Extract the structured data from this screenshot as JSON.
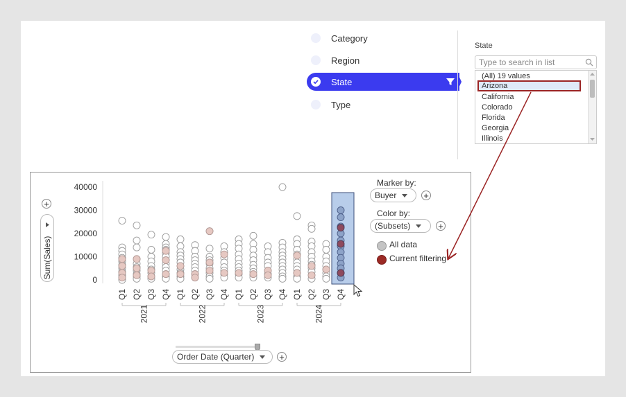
{
  "filters": {
    "items": [
      {
        "label": "Category",
        "selected": false
      },
      {
        "label": "Region",
        "selected": false
      },
      {
        "label": "State",
        "selected": true
      },
      {
        "label": "Type",
        "selected": false
      }
    ]
  },
  "state_panel": {
    "title": "State",
    "search_placeholder": "Type to search in list",
    "items": [
      "(All) 19 values",
      "Arizona",
      "California",
      "Colorado",
      "Florida",
      "Georgia",
      "Illinois"
    ],
    "selected": "Arizona"
  },
  "viz": {
    "y_axis_pill": "Sum(Sales)",
    "x_axis_pill": "Order Date (Quarter)",
    "marker_by_label": "Marker by:",
    "marker_by_value": "Buyer",
    "color_by_label": "Color by:",
    "color_by_value": "(Subsets)",
    "legend": [
      {
        "label": "All data",
        "color": "#c4c4c4"
      },
      {
        "label": "Current filtering",
        "color": "#9b2a25"
      }
    ]
  },
  "chart_data": {
    "type": "scatter",
    "y_ticks": [
      "40000",
      "30000",
      "20000",
      "10000",
      "0"
    ],
    "ylim": [
      0,
      40000
    ],
    "quarter_labels": [
      "Q1",
      "Q2",
      "Q3",
      "Q4",
      "Q1",
      "Q2",
      "Q3",
      "Q4",
      "Q1",
      "Q2",
      "Q3",
      "Q4",
      "Q1",
      "Q2",
      "Q3",
      "Q4"
    ],
    "year_labels": [
      "2021",
      "2022",
      "2023",
      "2024"
    ],
    "highlighted_category_index": 15,
    "columns": [
      {
        "all": [
          25500,
          14000,
          12500,
          11000,
          9500,
          8000,
          6500,
          5000,
          3500,
          2000,
          1000,
          0
        ],
        "filtered": [
          9000,
          6000,
          3000,
          1000
        ]
      },
      {
        "all": [
          23500,
          17000,
          14000,
          9000,
          7000,
          5500,
          4000,
          2500,
          1500,
          500
        ],
        "filtered": [
          9000,
          5000,
          2000
        ]
      },
      {
        "all": [
          19500,
          13000,
          10000,
          8000,
          6000,
          4500,
          3000,
          1500,
          500
        ],
        "filtered": [
          4000,
          1500
        ]
      },
      {
        "all": [
          18500,
          15500,
          14000,
          13000,
          11500,
          10000,
          8500,
          7000,
          5500,
          4000,
          2500,
          1500,
          500
        ],
        "filtered": [
          12500,
          8500,
          2500
        ]
      },
      {
        "all": [
          17500,
          14500,
          12000,
          10500,
          9000,
          7500,
          6000,
          4500,
          3000,
          1500,
          500
        ],
        "filtered": [
          6000,
          2500
        ]
      },
      {
        "all": [
          15000,
          12500,
          10000,
          8500,
          7000,
          5500,
          4000,
          2500,
          1000
        ],
        "filtered": [
          2500,
          1000
        ]
      },
      {
        "all": [
          21000,
          13500,
          10000,
          8500,
          7000,
          5000,
          3000,
          1500,
          500
        ],
        "filtered": [
          21000,
          7500,
          4000
        ]
      },
      {
        "all": [
          14500,
          12000,
          9500,
          7500,
          5500,
          4000,
          2500,
          1000
        ],
        "filtered": [
          11000,
          3000
        ]
      },
      {
        "all": [
          17500,
          15500,
          13500,
          11000,
          9000,
          7000,
          5500,
          4000,
          2500,
          1000
        ],
        "filtered": [
          3000
        ]
      },
      {
        "all": [
          19000,
          15500,
          13000,
          10500,
          8500,
          6500,
          5000,
          3500,
          2000,
          1000
        ],
        "filtered": [
          2500
        ]
      },
      {
        "all": [
          14500,
          12000,
          9500,
          7500,
          6000,
          4000,
          2500,
          1000
        ],
        "filtered": [
          4000,
          2000
        ]
      },
      {
        "all": [
          40000,
          16000,
          14000,
          12000,
          10500,
          9000,
          7500,
          6000,
          4500,
          3000,
          1500,
          500
        ],
        "filtered": []
      },
      {
        "all": [
          27500,
          17500,
          15500,
          13000,
          11000,
          9000,
          7500,
          6000,
          4500,
          3000,
          1500,
          500
        ],
        "filtered": [
          10500,
          3000
        ]
      },
      {
        "all": [
          23500,
          22000,
          16500,
          14500,
          12000,
          10000,
          8000,
          6500,
          5000,
          3500,
          2000,
          500
        ],
        "filtered": [
          6000,
          2000
        ]
      },
      {
        "all": [
          15500,
          13000,
          10000,
          8000,
          6000,
          4500,
          3000,
          1500,
          500
        ],
        "filtered": [
          4500
        ]
      },
      {
        "all": [
          30000,
          27000,
          23000,
          20000,
          17000,
          14500,
          12000,
          9500,
          7000,
          5000,
          3000,
          1000
        ],
        "filtered": [
          22500,
          15500,
          3000
        ]
      }
    ]
  }
}
